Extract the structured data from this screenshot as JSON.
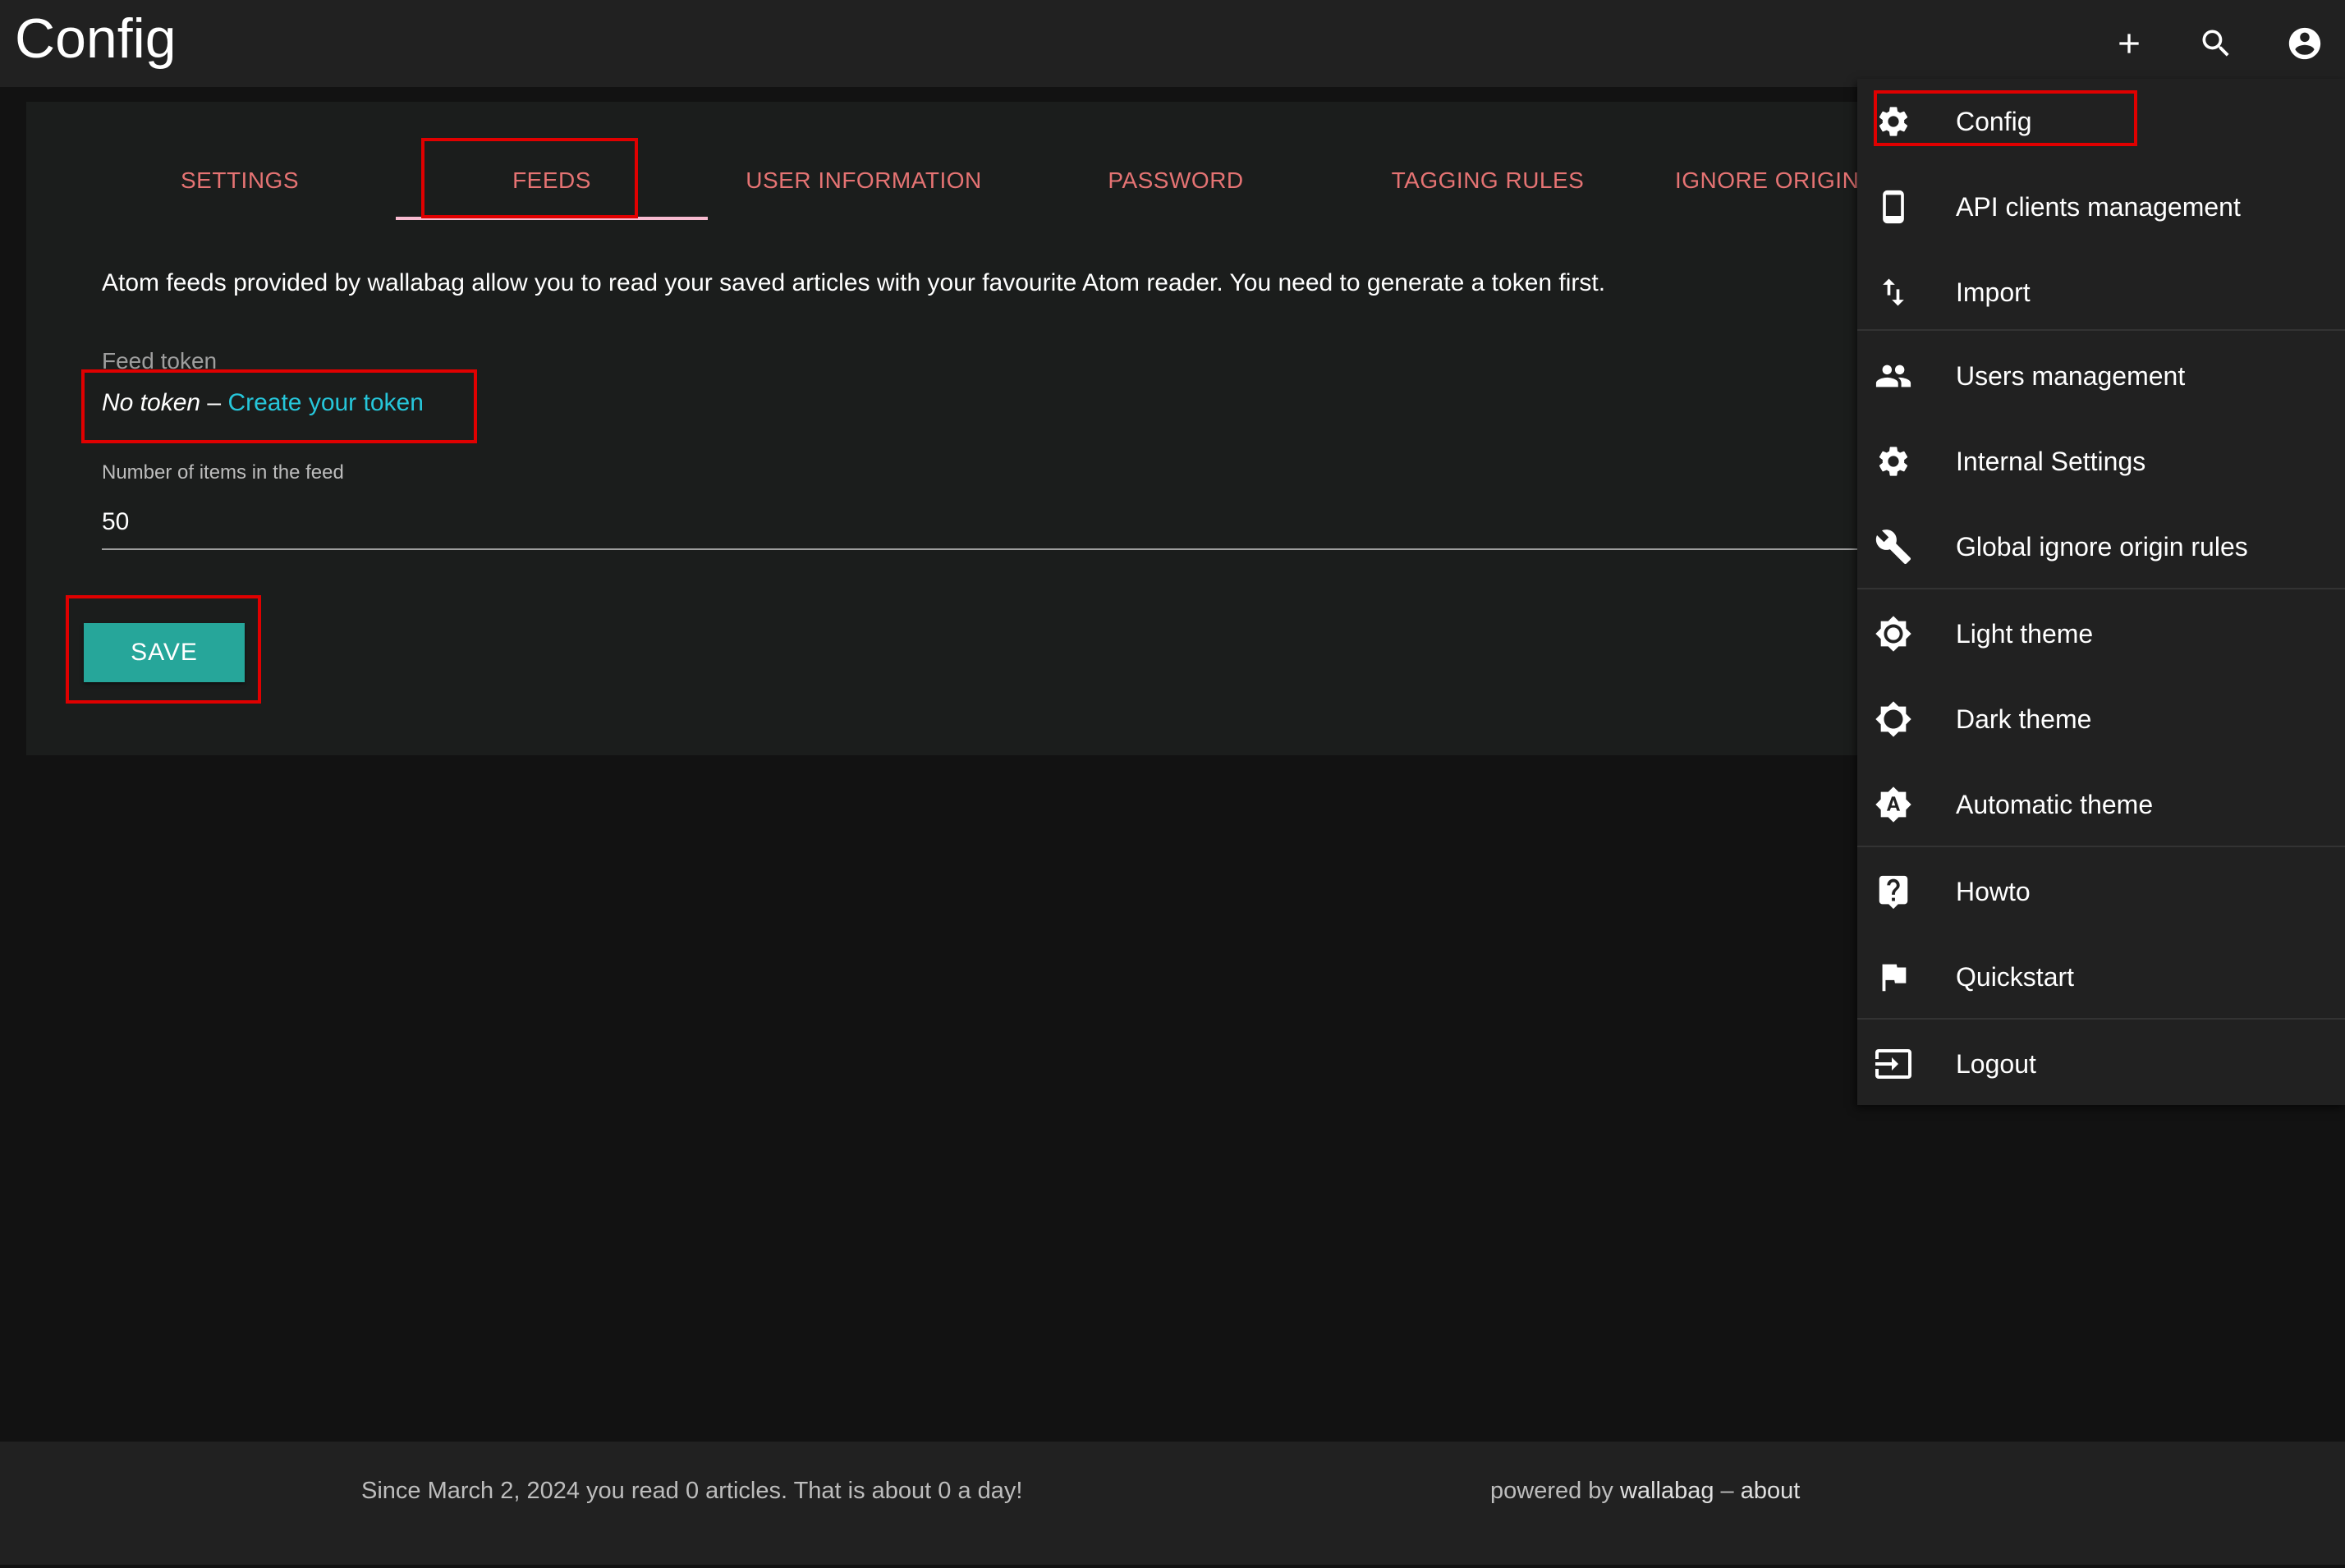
{
  "app": {
    "title": "Config"
  },
  "topbar": {
    "icons": [
      "add-icon",
      "search-icon",
      "account-circle-icon"
    ]
  },
  "tabs": [
    {
      "label": "SETTINGS",
      "active": false
    },
    {
      "label": "FEEDS",
      "active": true
    },
    {
      "label": "USER INFORMATION",
      "active": false
    },
    {
      "label": "PASSWORD",
      "active": false
    },
    {
      "label": "TAGGING RULES",
      "active": false
    },
    {
      "label": "IGNORE ORIGIN RULES",
      "active": false
    }
  ],
  "feeds": {
    "description": "Atom feeds provided by wallabag allow you to read your saved articles with your favourite Atom reader. You need to generate a token first.",
    "token_label": "Feed token",
    "no_token": "No token",
    "separator": " – ",
    "create_token": "Create your token",
    "items_label": "Number of items in the feed",
    "items_value": "50",
    "save_label": "SAVE"
  },
  "menu": {
    "items": [
      {
        "label": "Config",
        "icon": "gear-icon"
      },
      {
        "label": "API clients management",
        "icon": "phone-icon"
      },
      {
        "label": "Import",
        "icon": "import-icon"
      },
      {
        "label": "Users management",
        "icon": "users-icon"
      },
      {
        "label": "Internal Settings",
        "icon": "gear-icon"
      },
      {
        "label": "Global ignore origin rules",
        "icon": "wrench-icon"
      },
      {
        "label": "Light theme",
        "icon": "brightness-icon"
      },
      {
        "label": "Dark theme",
        "icon": "brightness-dark-icon"
      },
      {
        "label": "Automatic theme",
        "icon": "brightness-auto-icon"
      },
      {
        "label": "Howto",
        "icon": "help-icon"
      },
      {
        "label": "Quickstart",
        "icon": "flag-icon"
      },
      {
        "label": "Logout",
        "icon": "logout-icon"
      }
    ]
  },
  "footer": {
    "stats": "Since March 2, 2024 you read 0 articles. That is about 0 a day!",
    "powered_by": "powered by",
    "brand": "wallabag",
    "separator": " – ",
    "about": "about"
  },
  "colors": {
    "background": "#121212",
    "bar": "#212121",
    "card": "#1b1d1c",
    "tab_text": "#e57373",
    "accent": "#26a69a",
    "link": "#26c6da",
    "highlight": "#e00000"
  }
}
